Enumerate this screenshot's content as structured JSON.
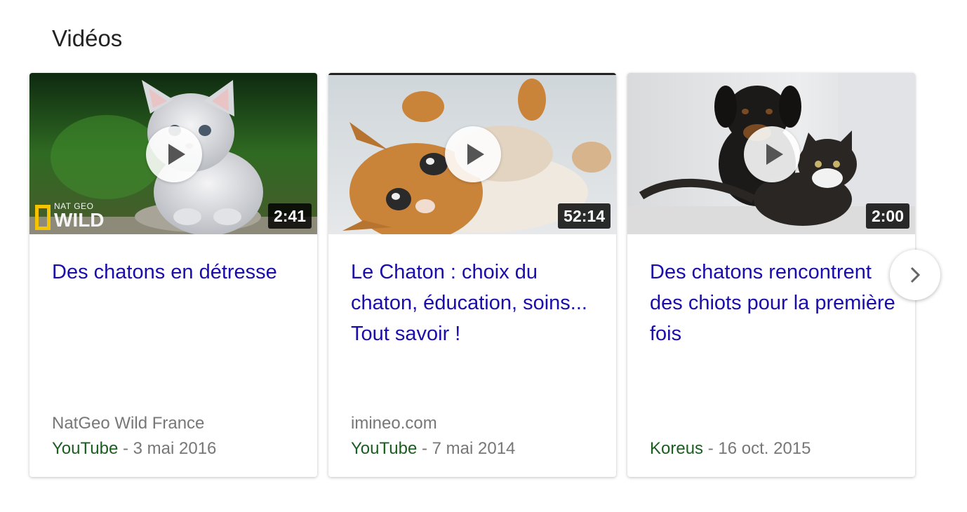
{
  "section": {
    "title": "Vidéos"
  },
  "videos": [
    {
      "title": "Des chatons en détresse",
      "duration": "2:41",
      "author": "NatGeo Wild France",
      "source": "YouTube",
      "date": "- 3 mai 2016",
      "watermark": {
        "line1": "NAT GEO",
        "line2": "WILD"
      }
    },
    {
      "title": "Le Chaton : choix du chaton, éducation, soins... Tout savoir !",
      "duration": "52:14",
      "author": "imineo.com",
      "source": "YouTube",
      "date": "- 7 mai 2014"
    },
    {
      "title": "Des chatons rencontrent des chiots pour la première fois",
      "duration": "2:00",
      "author": "",
      "source": "Koreus",
      "date": "- 16 oct. 2015"
    }
  ],
  "colors": {
    "link": "#1a0dab",
    "source": "#1a5e20",
    "meta": "#777777"
  },
  "icons": {
    "play": "play-icon",
    "next": "chevron-right-icon"
  }
}
